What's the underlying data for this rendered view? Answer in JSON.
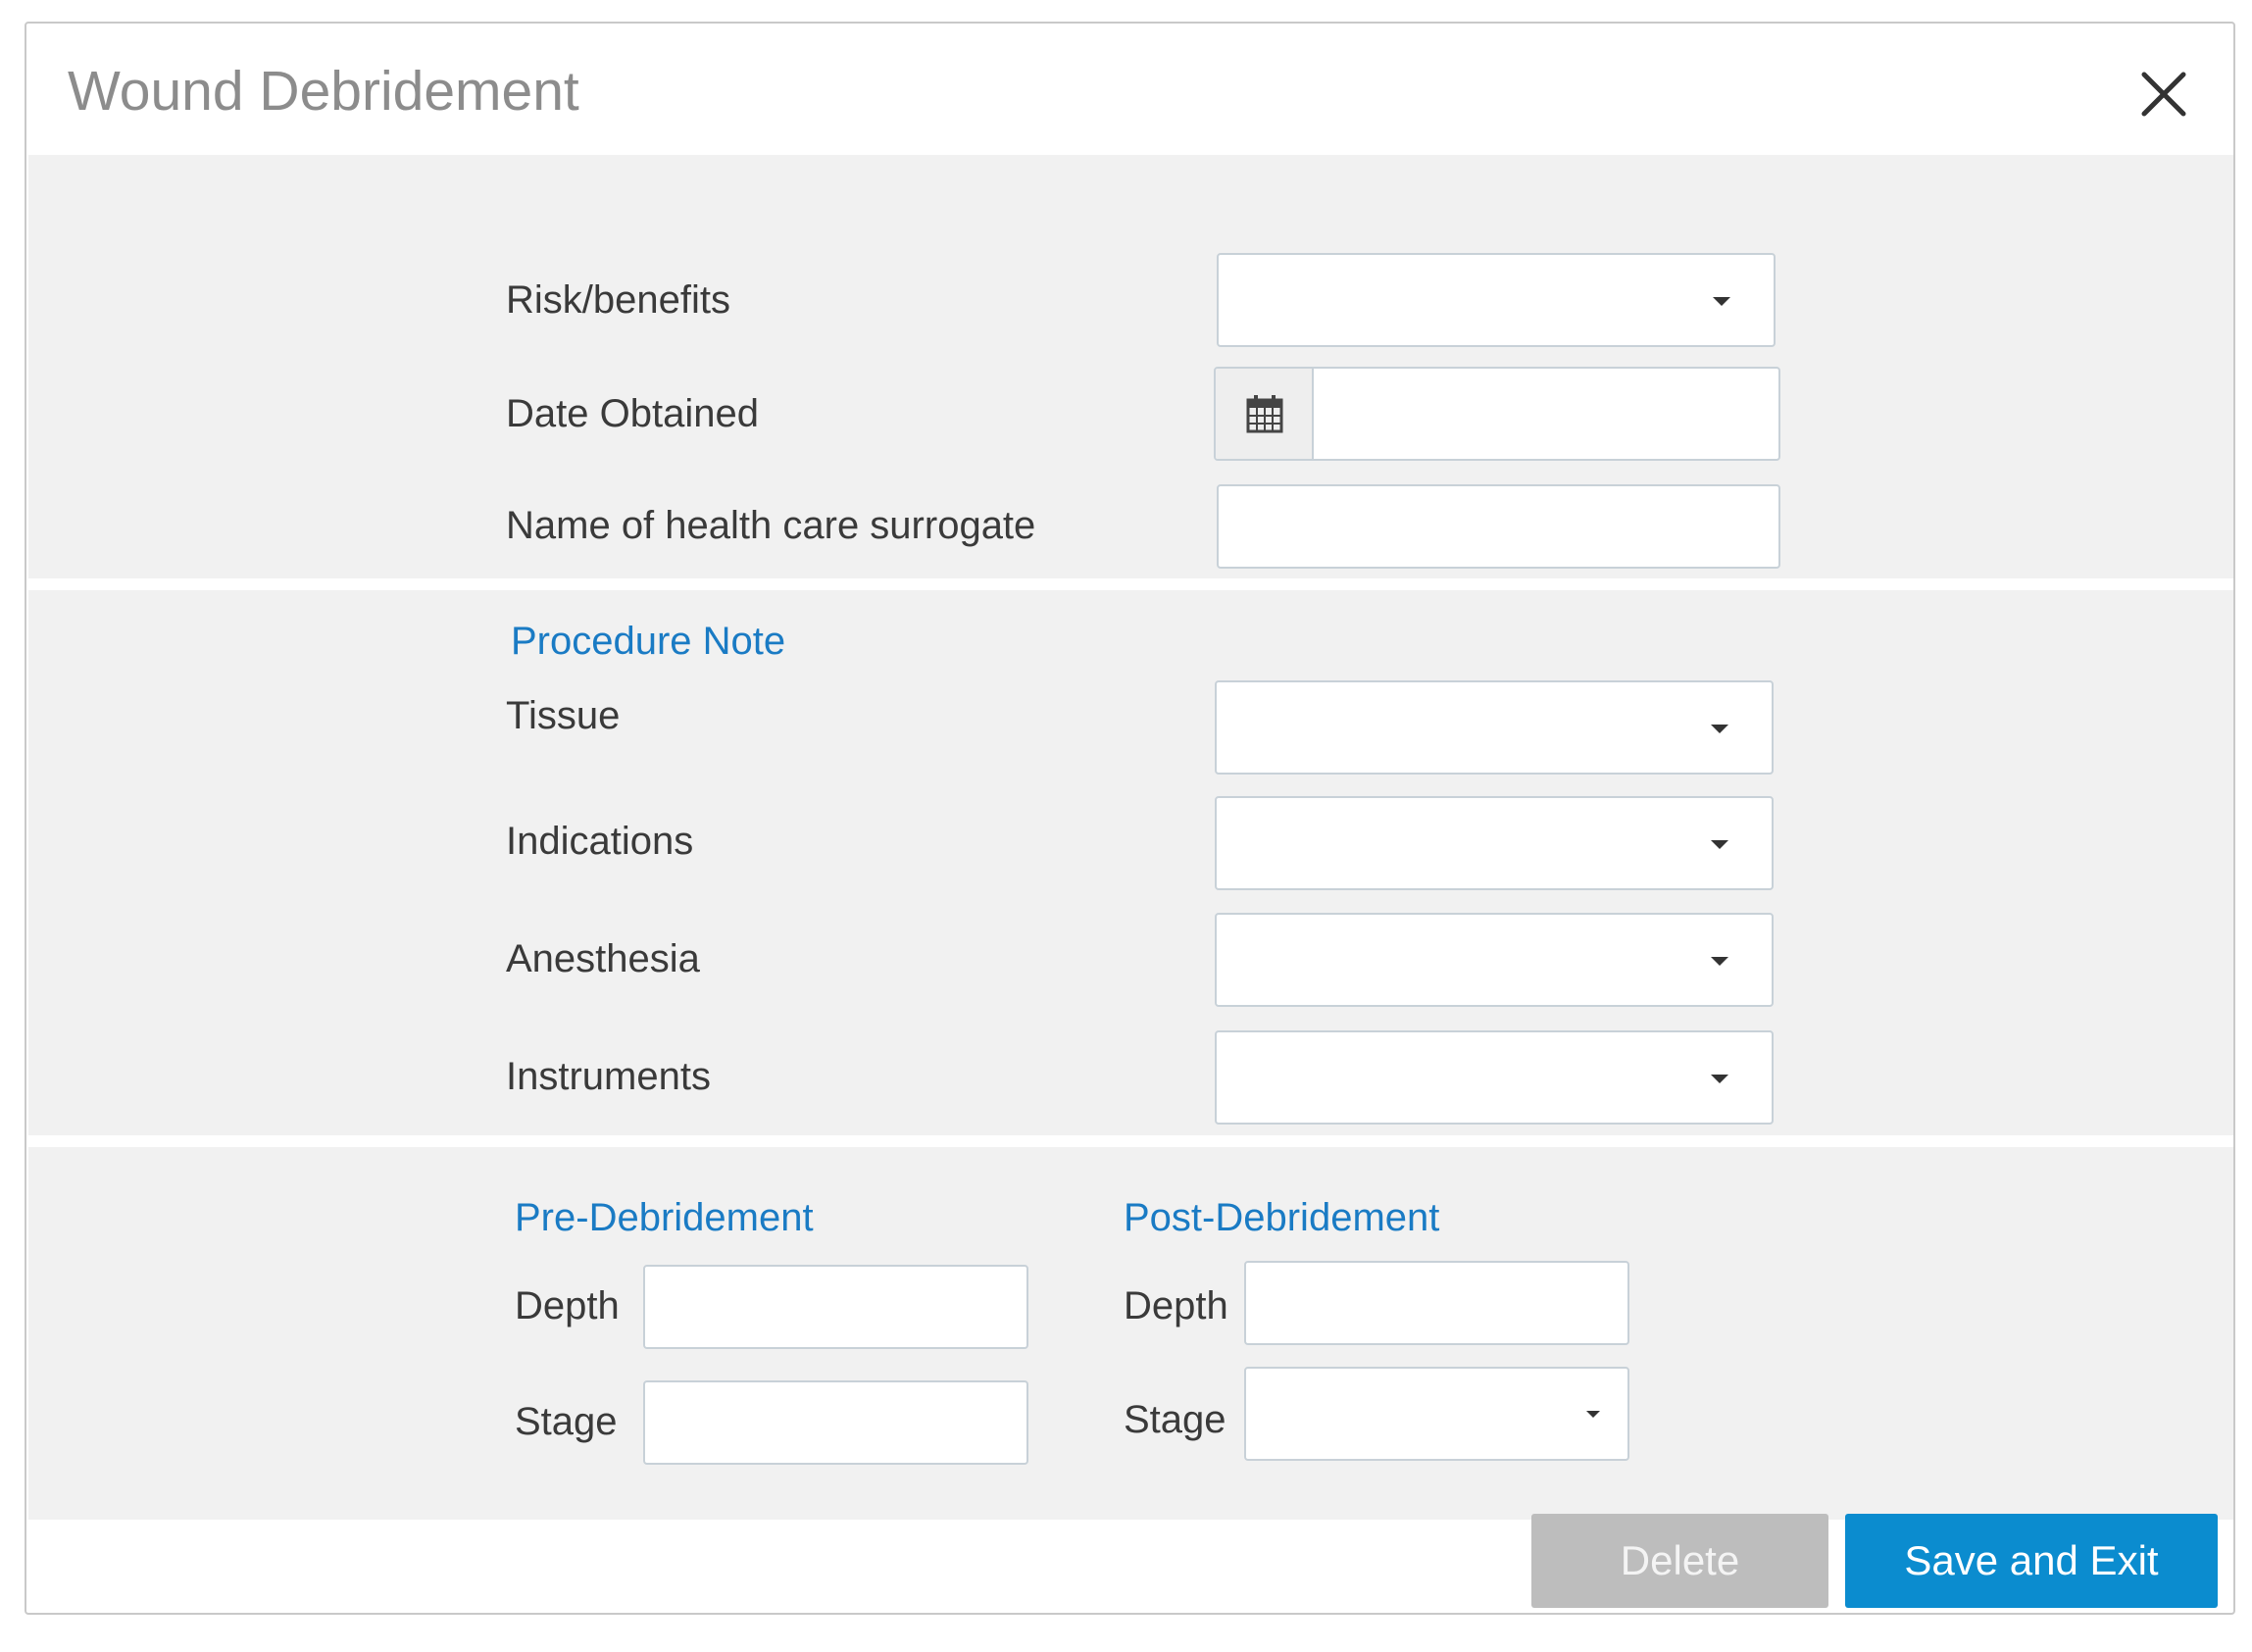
{
  "dialog": {
    "title": "Wound Debridement",
    "close_icon": "close-icon"
  },
  "consent": {
    "risk_benefits": {
      "label": "Risk/benefits",
      "value": ""
    },
    "date_obtained": {
      "label": "Date Obtained",
      "value": "",
      "icon": "calendar-icon"
    },
    "surrogate_name": {
      "label": "Name of health care surrogate",
      "value": ""
    }
  },
  "procedure_note": {
    "heading": "Procedure Note",
    "tissue": {
      "label": "Tissue",
      "value": ""
    },
    "indications": {
      "label": "Indications",
      "value": ""
    },
    "anesthesia": {
      "label": "Anesthesia",
      "value": ""
    },
    "instruments": {
      "label": "Instruments",
      "value": ""
    }
  },
  "pre_debridement": {
    "heading": "Pre-Debridement",
    "depth": {
      "label": "Depth",
      "value": ""
    },
    "stage": {
      "label": "Stage",
      "value": ""
    }
  },
  "post_debridement": {
    "heading": "Post-Debridement",
    "depth": {
      "label": "Depth",
      "value": ""
    },
    "stage": {
      "label": "Stage",
      "value": ""
    }
  },
  "footer": {
    "delete_label": "Delete",
    "save_label": "Save and Exit"
  },
  "colors": {
    "accent": "#1a7bc4",
    "primary_button": "#0b8ccf",
    "disabled_button": "#bdbdbd",
    "section_bg": "#f1f1f1"
  }
}
